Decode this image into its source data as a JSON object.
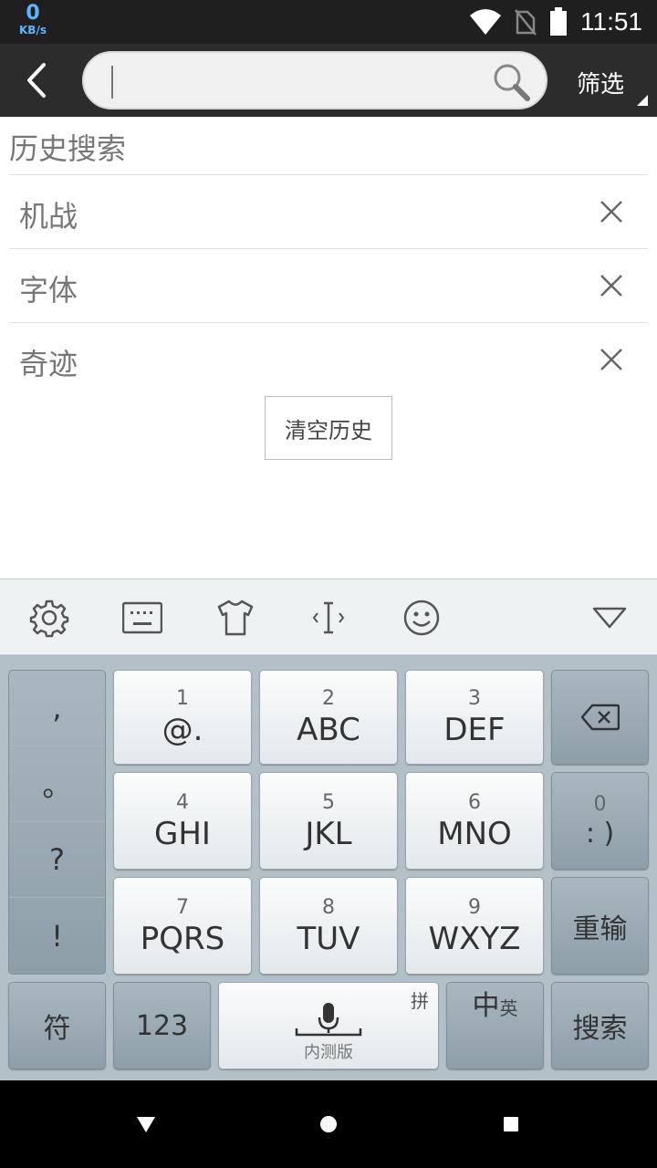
{
  "status_bar": {
    "net_speed_value": "0",
    "net_speed_unit": "KB/s",
    "time": "11:51",
    "icons": [
      "wifi-icon",
      "no-sim-icon",
      "battery-icon"
    ]
  },
  "app_bar": {
    "back_icon": "chevron-left-icon",
    "search": {
      "value": "",
      "placeholder": ""
    },
    "search_icon": "search-icon",
    "filter_label": "筛选"
  },
  "history": {
    "title": "历史搜索",
    "items": [
      {
        "label": "机战"
      },
      {
        "label": "字体"
      },
      {
        "label": "奇迹"
      }
    ],
    "clear_label": "清空历史"
  },
  "keyboard": {
    "toolbar_icons": [
      "gear-icon",
      "keyboard-icon",
      "tshirt-icon",
      "text-cursor-icon",
      "smiley-icon",
      "collapse-triangle-icon"
    ],
    "punctuation": [
      ",",
      "。",
      "?",
      "!"
    ],
    "keys": [
      {
        "num": "1",
        "letters": "@."
      },
      {
        "num": "2",
        "letters": "ABC"
      },
      {
        "num": "3",
        "letters": "DEF"
      },
      {
        "num": "4",
        "letters": "GHI"
      },
      {
        "num": "5",
        "letters": "JKL"
      },
      {
        "num": "6",
        "letters": "MNO"
      },
      {
        "num": "7",
        "letters": "PQRS"
      },
      {
        "num": "8",
        "letters": "TUV"
      },
      {
        "num": "9",
        "letters": "WXYZ"
      }
    ],
    "zero_key": {
      "num": "0",
      "label": ": )"
    },
    "reinput_label": "重输",
    "symbol_label": "符",
    "num_label": "123",
    "space_corner": "拼",
    "space_sub": "内测版",
    "lang_main": "中",
    "lang_sub": "英",
    "search_label": "搜索"
  },
  "nav_bar": {
    "icons": [
      "back-triangle-icon",
      "home-circle-icon",
      "recents-square-icon"
    ]
  },
  "colors": {
    "status_bar_bg": "#1f1f1f",
    "app_bar_bg": "#2c2c2c",
    "net_speed": "#5fb4ff",
    "keyboard_bg": "#b3c0c8"
  }
}
